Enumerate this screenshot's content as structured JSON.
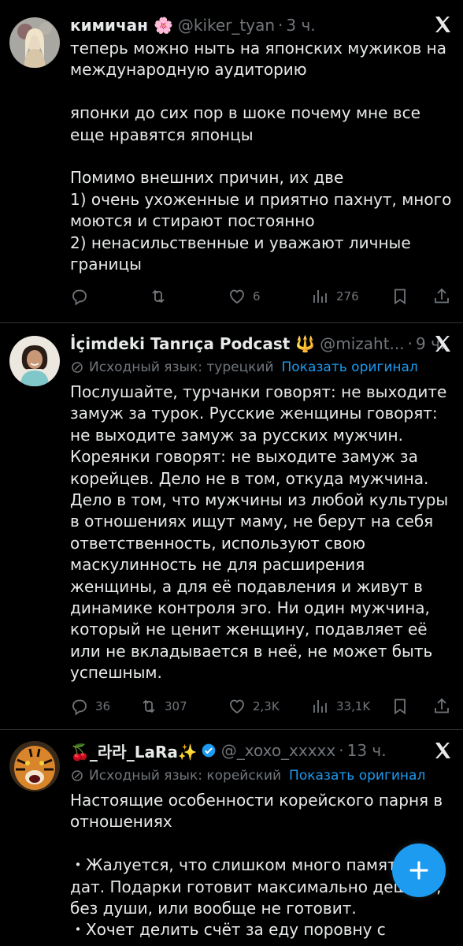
{
  "tweets": [
    {
      "name": "кимичан 🌸",
      "handle": "@kiker_tyan",
      "time": "3 ч.",
      "text": "теперь можно ныть на японских мужиков на международную аудиторию\n\nяпонки до сих пор в шоке почему мне все еще нравятся японцы\n\nПомимо внешних причин, их две\n1) очень ухоженные и приятно пахнут, много моются и стирают постоянно\n2) ненасильственные и уважают личные границы",
      "replies": "",
      "retweets": "",
      "likes": "6",
      "views": "276"
    },
    {
      "name": "İçimdeki Tanrıça Podcast 🔱",
      "handle": "@mizaht...",
      "time": "9 ч.",
      "translate_label": "Исходный язык: турецкий",
      "show_original": "Показать оригинал",
      "text": "Послушайте, турчанки говорят: не выходите замуж за турок. Русские женщины говорят: не выходите замуж за русских мужчин. Кореянки говорят: не выходите замуж за корейцев. Дело не в том, откуда мужчина. Дело в том, что мужчины из любой культуры в отношениях ищут маму, не берут на себя ответственность, используют свою маскулинность не для расширения женщины, а для её подавления и живут в динамике контроля эго. Ни один мужчина, который не ценит женщину, подавляет её или не вкладывается в неё, не может быть успешным.",
      "replies": "36",
      "retweets": "307",
      "likes": "2,3K",
      "views": "33,1K"
    },
    {
      "name": "🍒_라라_LaRa✨",
      "handle": "@_xoxo_xxxxx",
      "time": "13 ч.",
      "translate_label": "Исходный язык: корейский",
      "show_original": "Показать оригинал",
      "text": "Настоящие особенности корейского парня в отношениях\n\n・Жалуется, что слишком много памятных дат. Подарки готовит максимально дешево, без души, или вообще не готовит.\n・Хочет делить счёт за еду поровну с"
    }
  ],
  "colors": {
    "background": "#000000",
    "text": "#e7e9ea",
    "muted": "#71767b",
    "accent": "#1d9bf0",
    "divider": "#2f3336"
  },
  "icons": [
    "reply-icon",
    "retweet-icon",
    "like-icon",
    "views-icon",
    "bookmark-icon",
    "share-icon",
    "x-logo-icon",
    "verified-badge-icon",
    "translate-icon",
    "compose-icon"
  ]
}
